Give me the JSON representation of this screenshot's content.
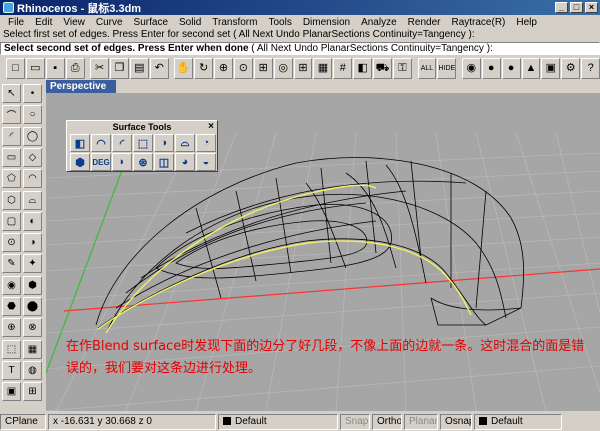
{
  "window": {
    "title": "Rhinoceros - 鼠标3.3dm",
    "min": "_",
    "max": "□",
    "close": "×"
  },
  "menu": [
    "File",
    "Edit",
    "View",
    "Curve",
    "Surface",
    "Solid",
    "Transform",
    "Tools",
    "Dimension",
    "Analyze",
    "Render",
    "Raytrace(R)",
    "Help"
  ],
  "command": {
    "history": "Select first set of edges. Press Enter for second set ( All Next Undo PlanarSections Continuity=Tangency ):",
    "prompt": "Select second set of edges. Press Enter when done",
    "options": " ( All Next Undo PlanarSections Continuity=Tangency ):"
  },
  "toolbar": {
    "buttons": [
      {
        "name": "new-file",
        "glyph": "□"
      },
      {
        "name": "open-file",
        "glyph": "▭"
      },
      {
        "name": "save-file",
        "glyph": "▪"
      },
      {
        "name": "print",
        "glyph": "⎙"
      },
      {
        "name": "cut",
        "glyph": "✂"
      },
      {
        "name": "copy",
        "glyph": "❐"
      },
      {
        "name": "paste",
        "glyph": "▤"
      },
      {
        "name": "undo",
        "glyph": "↶"
      },
      {
        "name": "pan",
        "glyph": "✋"
      },
      {
        "name": "rotate-view",
        "glyph": "↻"
      },
      {
        "name": "zoom-window",
        "glyph": "⊕"
      },
      {
        "name": "zoom-dynamic",
        "glyph": "⊙"
      },
      {
        "name": "zoom-extents",
        "glyph": "⊞"
      },
      {
        "name": "zoom-selected",
        "glyph": "◎"
      },
      {
        "name": "four-views",
        "glyph": "⊞"
      },
      {
        "name": "cplane",
        "glyph": "▦"
      },
      {
        "name": "grid",
        "glyph": "#"
      },
      {
        "name": "object-properties",
        "glyph": "◧"
      },
      {
        "name": "render-car",
        "glyph": "⛟"
      },
      {
        "name": "lock",
        "glyph": "⚿"
      },
      {
        "name": "show-all",
        "glyph": "ALL"
      },
      {
        "name": "hide",
        "glyph": "HIDE"
      },
      {
        "name": "color-wheel",
        "glyph": "◉"
      },
      {
        "name": "shaded-sphere",
        "glyph": "●"
      },
      {
        "name": "render-sphere",
        "glyph": "●"
      },
      {
        "name": "light",
        "glyph": "▲"
      },
      {
        "name": "render-preview",
        "glyph": "▣"
      },
      {
        "name": "options",
        "glyph": "⚙"
      },
      {
        "name": "help",
        "glyph": "?"
      }
    ]
  },
  "left_tools": [
    "↖",
    "•",
    "⌒",
    "○",
    "◜",
    "◯",
    "▭",
    "◇",
    "⬠",
    "◠",
    "⬡",
    "⌓",
    "▢",
    "◐",
    "⊙",
    "◑",
    "✎",
    "✦",
    "◉",
    "⬢",
    "⬣",
    "⬤",
    "⊕",
    "⊗",
    "⬚",
    "▦",
    "T",
    "◍",
    "▣",
    "⊞"
  ],
  "viewport": {
    "label": "Perspective"
  },
  "surface_tools": {
    "title": "Surface Tools",
    "close": "×",
    "buttons": [
      "◧",
      "◠",
      "◜",
      "⬚",
      "◑",
      "⌓",
      "◔",
      "⬢",
      "DEG",
      "◗",
      "⊛",
      "◫",
      "◕",
      "◒"
    ]
  },
  "annotation": "在作Blend surface时发现下面的边分了好几段，不像上面的边就一条。这时混合的面是错误的，我们要对这条边进行处理。",
  "status": {
    "cplane": "CPlane",
    "coords": "x -16.631  y 30.668  z 0",
    "layer": "Default",
    "snap": "Snap",
    "ortho": "Ortho",
    "planar": "Planar",
    "osnap": "Osnap",
    "layer2": "Default"
  }
}
